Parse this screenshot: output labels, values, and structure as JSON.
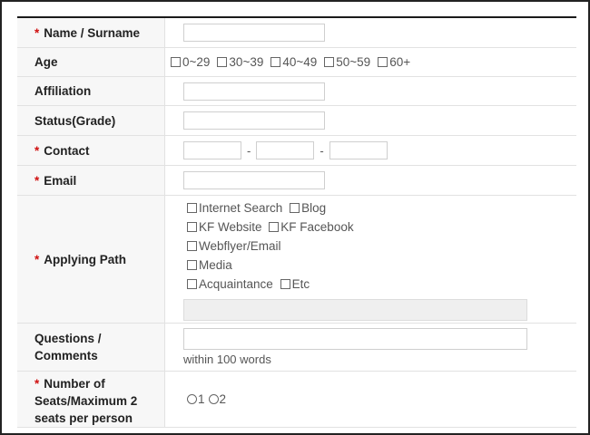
{
  "form": {
    "rows": {
      "name": {
        "label": "Name / Surname",
        "required": "*",
        "value": ""
      },
      "age": {
        "label": "Age",
        "options": [
          "0~29",
          "30~39",
          "40~49",
          "50~59",
          "60+"
        ]
      },
      "affiliation": {
        "label": "Affiliation",
        "value": ""
      },
      "status": {
        "label": "Status(Grade)",
        "value": ""
      },
      "contact": {
        "label": "Contact",
        "required": "*",
        "sep": "-",
        "parts": [
          "",
          "",
          ""
        ]
      },
      "email": {
        "label": "Email",
        "required": "*",
        "value": ""
      },
      "path": {
        "label": "Applying Path",
        "required": "*",
        "options": [
          "Internet Search",
          "Blog",
          "KF Website",
          "KF Facebook",
          "Webflyer/Email",
          "Media",
          "Acquaintance",
          "Etc"
        ],
        "etc_value": ""
      },
      "questions": {
        "label": "Questions / Comments",
        "hint": "within 100 words",
        "value": ""
      },
      "seats": {
        "label": "Number of Seats/Maximum 2 seats per person",
        "required": "*",
        "options": [
          "1",
          "2"
        ]
      }
    }
  },
  "colors": {
    "required_mark": "#d01010",
    "label_background": "#f7f7f7",
    "border": "#e2e2e2",
    "top_rule": "#1a1a1a"
  },
  "icons": {
    "checkbox": "checkbox-icon",
    "radio": "radio-icon"
  }
}
